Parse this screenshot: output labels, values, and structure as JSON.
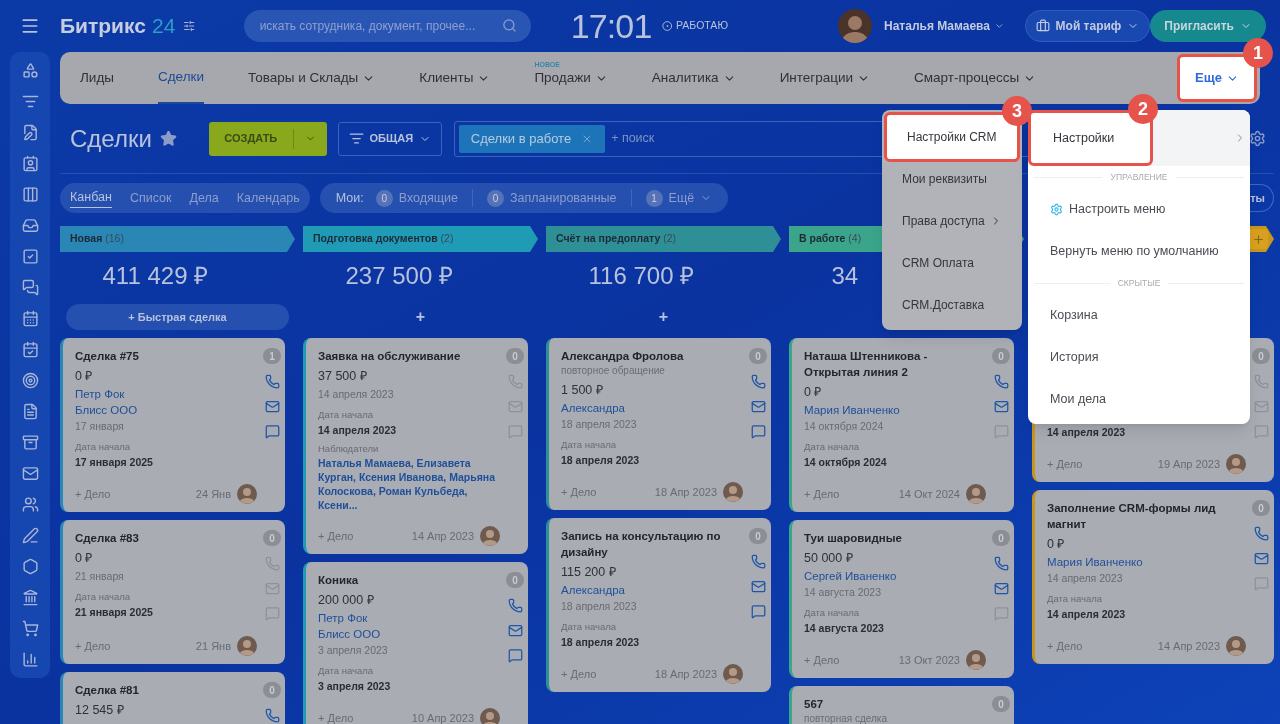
{
  "topbar": {
    "logo": "Битрикс",
    "logo_number": "24",
    "search": {
      "placeholder": "искать сотрудника, документ, прочее..."
    },
    "time": "17:01",
    "status": "РАБОТАЮ",
    "user": "Наталья Мамаева",
    "tariff": "Мой тариф",
    "invite": "Пригласить"
  },
  "nav": {
    "items": [
      {
        "label": "Лиды",
        "selected": false,
        "dropdown": false
      },
      {
        "label": "Сделки",
        "selected": true,
        "dropdown": false
      },
      {
        "label": "Товары и Склады",
        "selected": false,
        "dropdown": true
      },
      {
        "label": "Клиенты",
        "selected": false,
        "dropdown": true
      },
      {
        "label": "Продажи",
        "badge": "НОВОЕ",
        "selected": false,
        "dropdown": true
      },
      {
        "label": "Аналитика",
        "selected": false,
        "dropdown": true
      },
      {
        "label": "Интеграции",
        "selected": false,
        "dropdown": true
      },
      {
        "label": "Смарт-процессы",
        "selected": false,
        "dropdown": true
      }
    ],
    "more": {
      "label": "Еще",
      "callout": "1"
    }
  },
  "toolbar": {
    "title": "Сделки",
    "create": "СОЗДАТЬ",
    "filter": "ОБЩАЯ",
    "filter_tag": "Сделки в работе",
    "search_placeholder": "+ поиск"
  },
  "views": [
    {
      "label": "Канбан",
      "selected": true
    },
    {
      "label": "Список",
      "selected": false
    },
    {
      "label": "Дела",
      "selected": false
    },
    {
      "label": "Календарь",
      "selected": false
    }
  ],
  "counters": {
    "label": "Мои:",
    "items": [
      {
        "count": "0",
        "label": "Входящие",
        "dropdown": false
      },
      {
        "count": "0",
        "label": "Запланированные",
        "dropdown": false
      },
      {
        "count": "1",
        "label": "Ещё",
        "dropdown": true
      }
    ]
  },
  "right_button_fragment": "ты",
  "columns": [
    {
      "title": "Новая",
      "count": "(16)",
      "color": "#2a86b5",
      "total": "411 429 ₽",
      "add": "+ Быстрая сделка",
      "cards": [
        {
          "title": "Сделка #75",
          "count": "1",
          "amount": "0 ₽",
          "contacts": [
            "Петр Фок",
            "Блисс ООО"
          ],
          "date": "17 января",
          "start_label": "Дата начала",
          "start_date": "17 января 2025",
          "activity": "+ Дело",
          "last_date": "24 Янв",
          "phone": true,
          "mail": true,
          "chat": true
        },
        {
          "title": "Сделка #83",
          "count": "0",
          "amount": "0 ₽",
          "date": "21 января",
          "start_label": "Дата начала",
          "start_date": "21 января 2025",
          "activity": "+ Дело",
          "last_date": "21 Янв",
          "phone": false,
          "mail": false,
          "chat": false
        },
        {
          "title": "Сделка #81",
          "count": "0",
          "amount": "12 545 ₽",
          "phone": true
        }
      ]
    },
    {
      "title": "Подготовка документов",
      "count": "(2)",
      "color": "#1f9bb5",
      "total": "237 500 ₽",
      "add": "+",
      "cards": [
        {
          "title": "Заявка на обслуживание",
          "count": "0",
          "amount": "37 500 ₽",
          "date": "14 апреля 2023",
          "start_label": "Дата начала",
          "start_date": "14 апреля 2023",
          "observers_label": "Наблюдатели",
          "observers": "Наталья Мамаева, Елизавета Курган, Ксения Иванова, Марьяна Колоскова, Роман Кульбеда, Ксени...",
          "activity": "+ Дело",
          "last_date": "14 Апр 2023",
          "phone": false,
          "mail": false,
          "chat": false
        },
        {
          "title": "Коника",
          "count": "0",
          "amount": "200 000 ₽",
          "contacts": [
            "Петр Фок",
            "Блисс ООО"
          ],
          "date": "3 апреля 2023",
          "start_label": "Дата начала",
          "start_date": "3 апреля 2023",
          "activity": "+ Дело",
          "last_date": "10 Апр 2023",
          "phone": true,
          "mail": true,
          "chat": true
        }
      ]
    },
    {
      "title": "Счёт на предоплату",
      "count": "(2)",
      "color": "#2f8f96",
      "total": "116 700 ₽",
      "add": "+",
      "cards": [
        {
          "title": "Александра Фролова",
          "subtitle": "повторное обращение",
          "count": "0",
          "amount": "1 500 ₽",
          "contacts": [
            "Александра"
          ],
          "date": "18 апреля 2023",
          "start_label": "Дата начала",
          "start_date": "18 апреля 2023",
          "activity": "+ Дело",
          "last_date": "18 Апр 2023",
          "phone": true,
          "mail": true,
          "chat": true
        },
        {
          "title": "Запись на консультацию по дизайну",
          "count": "0",
          "amount": "115 200 ₽",
          "contacts": [
            "Александра"
          ],
          "date": "18 апреля 2023",
          "start_label": "Дата начала",
          "start_date": "18 апреля 2023",
          "activity": "+ Дело",
          "last_date": "18 Апр 2023",
          "phone": true,
          "mail": true,
          "chat": true
        }
      ]
    },
    {
      "title": "В работе",
      "count": "(4)",
      "color": "#3aa58a",
      "total": "34",
      "cards": [
        {
          "title": "Наташа Штенникова - Открытая линия 2",
          "count": "0",
          "amount": "0 ₽",
          "contacts": [
            "Мария Иванченко"
          ],
          "date": "14 октября 2024",
          "start_label": "Дата начала",
          "start_date": "14 октября 2024",
          "activity": "+ Дело",
          "last_date": "14 Окт 2024",
          "phone": true,
          "mail": true,
          "chat": false
        },
        {
          "title": "Туи шаровидные",
          "count": "0",
          "amount": "50 000 ₽",
          "contacts": [
            "Сергей Иваненко"
          ],
          "date": "14 августа 2023",
          "start_label": "Дата начала",
          "start_date": "14 августа 2023",
          "activity": "+ Дело",
          "last_date": "13 Окт 2023",
          "phone": true,
          "mail": true,
          "chat": false
        },
        {
          "title": "567",
          "subtitle": "повторная сделка",
          "count": "0"
        }
      ]
    },
    {
      "color": "#c9961c",
      "cards": [
        {
          "count": "0",
          "start_date": "14 апреля 2023",
          "activity": "+ Дело",
          "last_date": "19 Апр 2023",
          "phone": false,
          "mail": false,
          "chat": false
        },
        {
          "title": "Заполнение CRM-формы лид магнит",
          "count": "0",
          "amount": "0 ₽",
          "contacts": [
            "Мария Иванченко"
          ],
          "date": "14 апреля 2023",
          "start_label": "Дата начала",
          "start_date": "14 апреля 2023",
          "activity": "+ Дело",
          "last_date": "14 Апр 2023",
          "phone": true,
          "mail": true,
          "chat": false
        }
      ]
    }
  ],
  "submenu": {
    "items": [
      {
        "label": "Настройки CRM",
        "selected": true,
        "callout": "3",
        "arrow": false
      },
      {
        "label": "Мои реквизиты",
        "selected": false,
        "arrow": false
      },
      {
        "label": "Права доступа",
        "selected": false,
        "arrow": true
      },
      {
        "label": "CRM Оплата",
        "selected": false,
        "arrow": false
      },
      {
        "label": "CRM.Доставка",
        "selected": false,
        "arrow": false
      }
    ]
  },
  "menu": {
    "items": [
      {
        "kind": "item",
        "label": "Настройки",
        "selected": true,
        "callout": "2",
        "arrow": true
      },
      {
        "kind": "section",
        "label": "УПРАВЛЕНИЕ"
      },
      {
        "kind": "item",
        "label": "Настроить меню",
        "selected": false,
        "gear": true
      },
      {
        "kind": "item",
        "label": "Вернуть меню по умолчанию",
        "selected": false
      },
      {
        "kind": "section",
        "label": "СКРЫТЫЕ"
      },
      {
        "kind": "item",
        "label": "Корзина",
        "selected": false
      },
      {
        "kind": "item",
        "label": "История",
        "selected": false
      },
      {
        "kind": "item",
        "label": "Мои дела",
        "selected": false
      }
    ]
  }
}
